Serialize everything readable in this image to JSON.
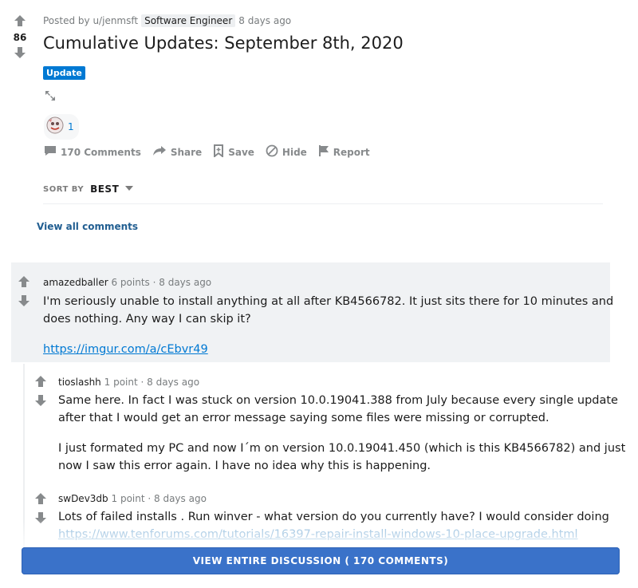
{
  "post": {
    "score": "86",
    "posted_by": "Posted by u/jenmsft",
    "user_flair": "Software Engineer",
    "time": "8 days ago",
    "title": "Cumulative Updates: September 8th, 2020",
    "post_flair": "Update",
    "award_count": "1"
  },
  "actions": {
    "comments": "170 Comments",
    "share": "Share",
    "save": "Save",
    "hide": "Hide",
    "report": "Report"
  },
  "sort": {
    "label": "SORT BY",
    "value": "BEST"
  },
  "view_all_comments": "View all comments",
  "comments": [
    {
      "author": "amazedballer",
      "points": "6 points",
      "time": "8 days ago",
      "lines": [
        "I'm seriously unable to install anything at all after KB4566782. It just sits there for 10 minutes and",
        "does nothing. Any way I can skip it?"
      ],
      "link": "https://imgur.com/a/cEbvr49"
    },
    {
      "author": "tioslashh",
      "points": "1 point",
      "time": "8 days ago",
      "lines": [
        "Same here. In fact I was stuck on version 10.0.19041.388 from July because every single update",
        "after that I would get an error message saying some files were missing or corrupted."
      ],
      "lines2": [
        "I just formated my PC and now I´m on version 10.0.19041.450 (which is this KB4566782) and just",
        "now I saw this error again. I have no idea why this is happening."
      ]
    },
    {
      "author": "swDev3db",
      "points": "1 point",
      "time": "8 days ago",
      "lines": [
        "Lots of failed installs . Run winver - what version do you currently have? I would consider doing"
      ],
      "link": "https://www.tenforums.com/tutorials/16397-repair-install-windows-10-place-upgrade.html"
    }
  ],
  "view_discussion": "VIEW ENTIRE DISCUSSION ( 170 COMMENTS)",
  "colors": {
    "accent": "#0079d3",
    "button": "#3a72c9",
    "comment_bg": "#f0f2f4",
    "muted": "#878a8c"
  },
  "icons": [
    "upvote-icon",
    "downvote-icon",
    "expand-icon",
    "award-icon",
    "comment-icon",
    "share-icon",
    "save-icon",
    "hide-icon",
    "report-icon",
    "chevron-down-icon"
  ]
}
